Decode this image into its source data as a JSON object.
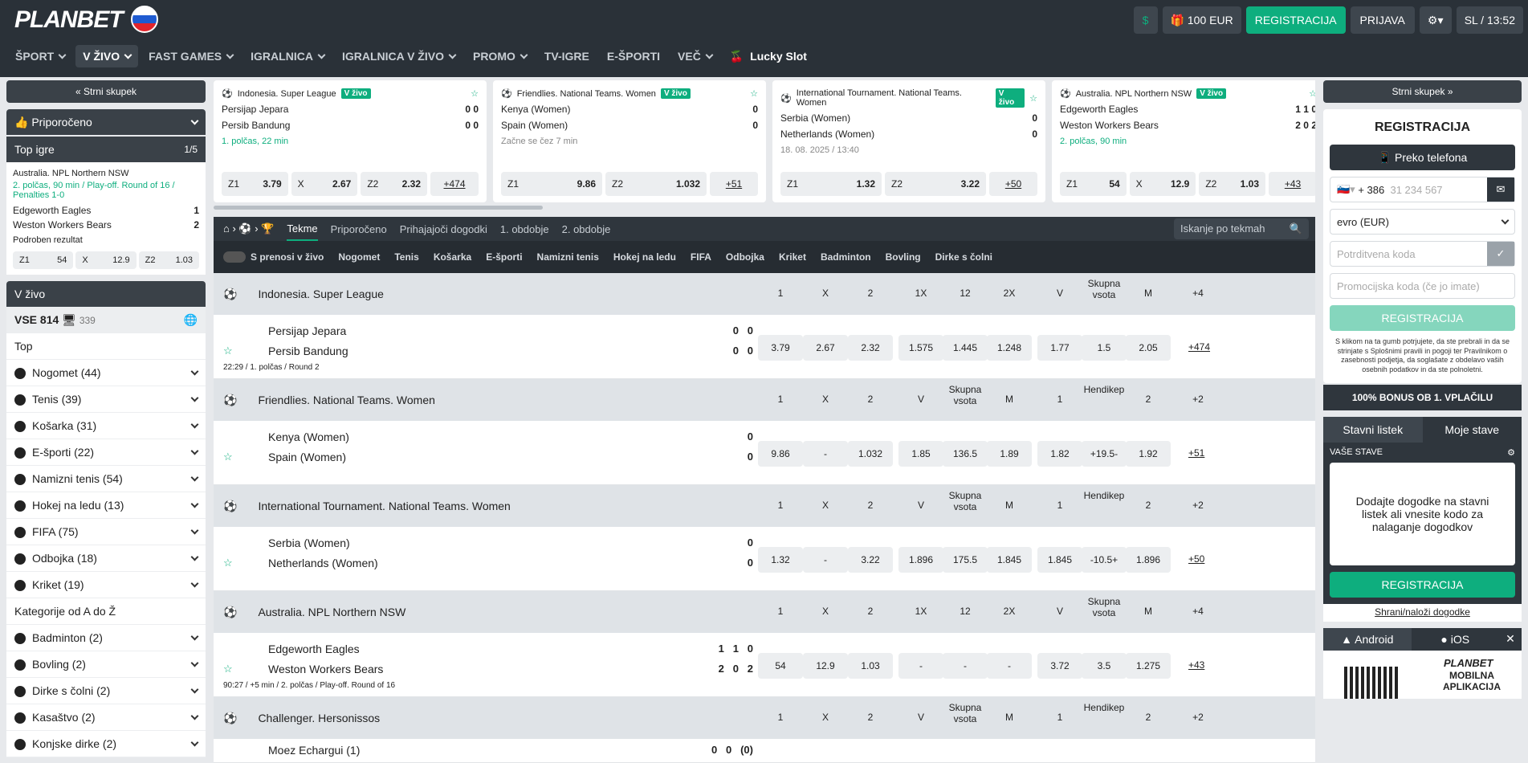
{
  "header": {
    "logo": "PLANBET",
    "balance": "100 EUR",
    "register": "REGISTRACIJA",
    "login": "PRIJAVA",
    "locale": "SL / 13:52"
  },
  "nav": [
    "ŠPORT",
    "V ŽIVO",
    "FAST GAMES",
    "IGRALNICA",
    "IGRALNICA V ŽIVO",
    "PROMO",
    "TV-IGRE",
    "E-ŠPORTI",
    "VEČ",
    "Lucky Slot"
  ],
  "left": {
    "collapse": "« Strni skupek",
    "recommended": "Priporočeno",
    "topgames": "Top igre",
    "topcount": "1/5",
    "top_event": {
      "league": "Australia. NPL Northern NSW",
      "info": "2. polčas, 90 min / Play-off. Round of 16 / Penalties 1-0",
      "team1": "Edgeworth Eagles",
      "team2": "Weston Workers Bears",
      "s1": "1",
      "s2": "2",
      "detail": "Podroben rezultat",
      "z1": "Z1",
      "o1": "54",
      "x": "X",
      "ox": "12.9",
      "z2": "Z2",
      "o2": "1.03"
    },
    "live": "V živo",
    "all": "VSE 814",
    "allcount": "339",
    "top": "Top",
    "sports": [
      "Nogomet (44)",
      "Tenis (39)",
      "Košarka (31)",
      "E-športi (22)",
      "Namizni tenis (54)",
      "Hokej na ledu (13)",
      "FIFA (75)",
      "Odbojka (18)",
      "Kriket (19)"
    ],
    "az": "Kategorije od A do Ž",
    "az_items": [
      "Badminton (2)",
      "Bovling (2)",
      "Dirke s čolni (2)",
      "Kasaštvo (2)",
      "Konjske dirke (2)"
    ]
  },
  "cards": [
    {
      "league": "Indonesia. Super League",
      "live": "V živo",
      "t1": "Persijap Jepara",
      "t2": "Persib Bandung",
      "s1": "0 0",
      "s2": "0 0",
      "info": "1. polčas, 22 min",
      "odds": [
        [
          "Z1",
          "3.79"
        ],
        [
          "X",
          "2.67"
        ],
        [
          "Z2",
          "2.32"
        ]
      ],
      "more": "+474"
    },
    {
      "league": "Friendlies. National Teams. Women",
      "live": "V živo",
      "t1": "Kenya (Women)",
      "t2": "Spain (Women)",
      "s1": "0",
      "s2": "0",
      "info": "Začne se čez 7 min",
      "odds": [
        [
          "Z1",
          "9.86"
        ],
        [
          "Z2",
          "1.032"
        ]
      ],
      "more": "+51"
    },
    {
      "league": "International Tournament. National Teams. Women",
      "live": "V živo",
      "t1": "Serbia (Women)",
      "t2": "Netherlands (Women)",
      "s1": "0",
      "s2": "0",
      "info": "18. 08. 2025 / 13:40",
      "odds": [
        [
          "Z1",
          "1.32"
        ],
        [
          "Z2",
          "3.22"
        ]
      ],
      "more": "+50"
    },
    {
      "league": "Australia. NPL Northern NSW",
      "live": "V živo",
      "t1": "Edgeworth Eagles",
      "t2": "Weston Workers Bears",
      "s1": "1 1 0",
      "s2": "2 0 2",
      "info": "2. polčas, 90 min",
      "odds": [
        [
          "Z1",
          "54"
        ],
        [
          "X",
          "12.9"
        ],
        [
          "Z2",
          "1.03"
        ]
      ],
      "more": "+43"
    }
  ],
  "tabs": [
    "Tekme",
    "Priporočeno",
    "Prihajajoči dogodki",
    "1. obdobje",
    "2. obdobje"
  ],
  "search": "Iskanje po tekmah",
  "filters": [
    "S prenosi v živo",
    "Nogomet",
    "Tenis",
    "Košarka",
    "E-športi",
    "Namizni tenis",
    "Hokej na ledu",
    "FIFA",
    "Odbojka",
    "Kriket",
    "Badminton",
    "Bovling",
    "Dirke s čolni"
  ],
  "events": [
    {
      "league": "Indonesia. Super League",
      "cols": [
        "1",
        "X",
        "2",
        "1X",
        "12",
        "2X",
        "V",
        "Skupna vsota",
        "M",
        "+4"
      ],
      "t1": "Persijap Jepara",
      "t2": "Persib Bandung",
      "sc1": "0   0",
      "sc2": "0   0",
      "info": "22:29 / 1. polčas / Round 2",
      "odds": [
        "3.79",
        "2.67",
        "2.32",
        "1.575",
        "1.445",
        "1.248",
        "1.77",
        "1.5",
        "2.05"
      ],
      "more": "+474"
    },
    {
      "league": "Friendlies. National Teams. Women",
      "cols": [
        "1",
        "X",
        "2",
        "V",
        "Skupna vsota",
        "M",
        "1",
        "Hendikep",
        "2",
        "+2"
      ],
      "t1": "Kenya (Women)",
      "t2": "Spain (Women)",
      "sc1": "0",
      "sc2": "0",
      "info": "",
      "odds": [
        "9.86",
        "-",
        "1.032",
        "1.85",
        "136.5",
        "1.89",
        "1.82",
        "+19.5-",
        "1.92"
      ],
      "more": "+51"
    },
    {
      "league": "International Tournament. National Teams. Women",
      "cols": [
        "1",
        "X",
        "2",
        "V",
        "Skupna vsota",
        "M",
        "1",
        "Hendikep",
        "2",
        "+2"
      ],
      "t1": "Serbia (Women)",
      "t2": "Netherlands (Women)",
      "sc1": "0",
      "sc2": "0",
      "info": "",
      "odds": [
        "1.32",
        "-",
        "3.22",
        "1.896",
        "175.5",
        "1.845",
        "1.845",
        "-10.5+",
        "1.896"
      ],
      "more": "+50"
    },
    {
      "league": "Australia. NPL Northern NSW",
      "cols": [
        "1",
        "X",
        "2",
        "1X",
        "12",
        "2X",
        "V",
        "Skupna vsota",
        "M",
        "+4"
      ],
      "t1": "Edgeworth Eagles",
      "t2": "Weston Workers Bears",
      "sc1": "1   1   0",
      "sc2": "2   0   2",
      "info": "90:27 / +5 min / 2. polčas / Play-off. Round of 16",
      "odds": [
        "54",
        "12.9",
        "1.03",
        "-",
        "-",
        "-",
        "3.72",
        "3.5",
        "1.275"
      ],
      "more": "+43"
    }
  ],
  "last_league": {
    "league": "Challenger. Hersonissos",
    "cols": [
      "1",
      "X",
      "2",
      "V",
      "Skupna vsota",
      "M",
      "1",
      "Hendikep",
      "2",
      "+2"
    ],
    "team": "Moez Echargui (1)",
    "sc": "0   0   (0)"
  },
  "right": {
    "collapse": "Strni skupek »",
    "title": "REGISTRACIJA",
    "phone": "Preko telefona",
    "code": "+ 386",
    "phone_ph": "31 234 567",
    "currency": "evro (EUR)",
    "confirm_ph": "Potrditvena koda",
    "promo_ph": "Promocijska koda (če jo imate)",
    "reg": "REGISTRACIJA",
    "terms": "S klikom na ta gumb potrjujete, da ste prebrali in da se strinjate s Splošnimi pravili in pogoji ter Pravilnikom o zasebnosti podjetja, da soglašate z obdelavo vaših osebnih podatkov in da ste polnoletni.",
    "bonus": "100% BONUS OB 1. VPLAČILU",
    "slip": "Stavni listek",
    "mybets": "Moje stave",
    "yours": "VAŠE STAVE",
    "empty": "Dodajte dogodke na stavni listek ali vnesite kodo za nalaganje dogodkov",
    "reg2": "REGISTRACIJA",
    "save": "Shrani/naloži dogodke",
    "android": "Android",
    "ios": "iOS",
    "app1": "PLANBET",
    "app2": "MOBILNA APLIKACIJA"
  },
  "colors": {
    "green": "#0eae7e",
    "dark": "#2a3138"
  }
}
